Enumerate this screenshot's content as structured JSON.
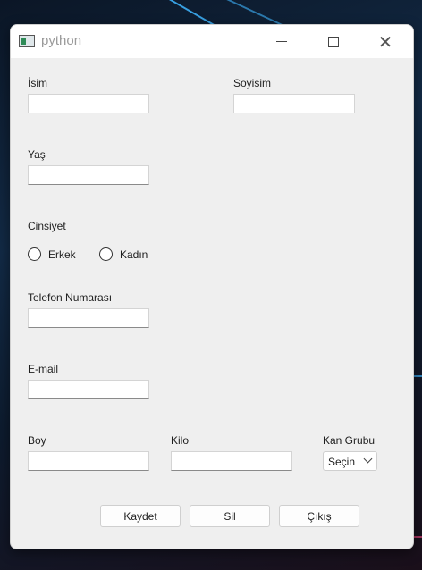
{
  "window": {
    "title": "python"
  },
  "form": {
    "isim_label": "İsim",
    "isim_value": "",
    "soyisim_label": "Soyisim",
    "soyisim_value": "",
    "yas_label": "Yaş",
    "yas_value": "",
    "cinsiyet_label": "Cinsiyet",
    "gender_options": [
      "Erkek",
      "Kadın"
    ],
    "telefon_label": "Telefon Numarası",
    "telefon_value": "",
    "email_label": "E-mail",
    "email_value": "",
    "boy_label": "Boy",
    "boy_value": "",
    "kilo_label": "Kilo",
    "kilo_value": "",
    "kan_grubu_label": "Kan Grubu",
    "kan_grubu_selected": "Seçin"
  },
  "buttons": {
    "save": "Kaydet",
    "delete": "Sil",
    "exit": "Çıkış"
  },
  "icons": {
    "app": "python-app-icon",
    "minimize": "minimize-icon",
    "maximize": "maximize-icon",
    "close": "close-icon",
    "dropdown": "chevron-down-icon"
  }
}
